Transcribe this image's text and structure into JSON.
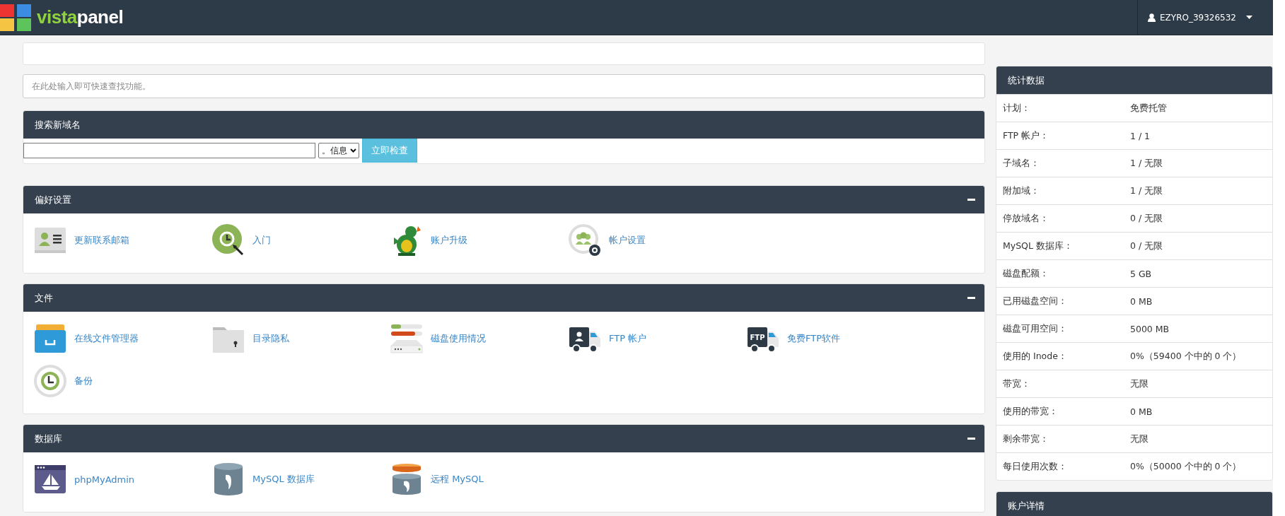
{
  "header": {
    "logo_part_1": "vista",
    "logo_part_2": "panel",
    "user": "EZYRO_39326532"
  },
  "search": {
    "placeholder": "在此处输入即可快速查找功能。"
  },
  "domain_search": {
    "title": "搜索新域名",
    "tld": "。信息",
    "button": "立即检查"
  },
  "sections": [
    {
      "title": "偏好设置",
      "items": [
        {
          "kind": "contact",
          "label": "更新联系邮箱"
        },
        {
          "kind": "start",
          "label": "入门"
        },
        {
          "kind": "mascot",
          "label": "账户升级"
        },
        {
          "kind": "settings",
          "label": "帐户设置"
        }
      ]
    },
    {
      "title": "文件",
      "items": [
        {
          "kind": "filemanager",
          "label": "在线文件管理器"
        },
        {
          "kind": "folder",
          "label": "目录隐私"
        },
        {
          "kind": "disk",
          "label": "磁盘使用情况"
        },
        {
          "kind": "truck",
          "label": "FTP 帐户"
        },
        {
          "kind": "truck_text",
          "badge": "FTP",
          "label": "免费FTP软件"
        },
        {
          "kind": "backup",
          "label": "备份"
        }
      ]
    },
    {
      "title": "数据库",
      "items": [
        {
          "kind": "phpmyadmin",
          "label": "phpMyAdmin"
        },
        {
          "kind": "database",
          "label": "MySQL 数据库"
        },
        {
          "kind": "remote_database",
          "label": "远程 MySQL"
        }
      ]
    }
  ],
  "stats": {
    "title": "统计数据",
    "rows": [
      {
        "label": "计划：",
        "value": "免费托管"
      },
      {
        "label": "FTP 帐户：",
        "value": "1 / 1"
      },
      {
        "label": "子域名：",
        "value": "1 / 无限"
      },
      {
        "label": "附加域：",
        "value": "1 / 无限"
      },
      {
        "label": "停放域名：",
        "value": "0 / 无限"
      },
      {
        "label": "MySQL 数据库：",
        "value": "0 / 无限"
      },
      {
        "label": "磁盘配额：",
        "value": "5 GB"
      },
      {
        "label": "已用磁盘空间：",
        "value": "0 MB"
      },
      {
        "label": "磁盘可用空间：",
        "value": "5000 MB"
      },
      {
        "label": "使用的 Inode：",
        "value": "0%（59400 个中的 0 个）"
      },
      {
        "label": "带宽：",
        "value": "无限"
      },
      {
        "label": "使用的带宽：",
        "value": "0 MB"
      },
      {
        "label": "剩余带宽：",
        "value": "无限"
      },
      {
        "label": "每日使用次数：",
        "value": "0%（50000 个中的 0 个）"
      }
    ]
  },
  "account": {
    "title": "账户详情"
  }
}
